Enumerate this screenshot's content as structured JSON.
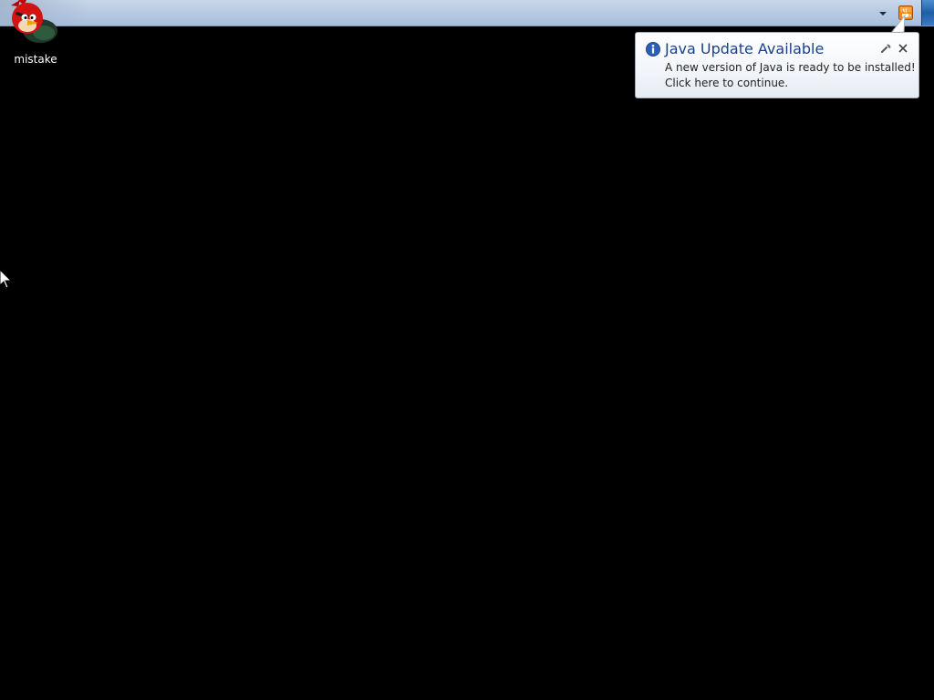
{
  "desktop": {
    "background_color": "#000000",
    "icons": [
      {
        "label": "mistake",
        "icon": "angry-bird-icon"
      }
    ]
  },
  "taskbar": {
    "tray": {
      "overflow_icon": "chevron-down-icon",
      "java_icon": "java-update-icon",
      "show_desktop": "show-desktop-button"
    }
  },
  "notification": {
    "icon": "info-icon",
    "title": "Java Update Available",
    "message_line1": "A new version of Java is ready to be installed!",
    "message_line2": "Click here to continue.",
    "title_color": "#1a3f8e",
    "options_icon": "wrench-icon",
    "close_icon": "close-icon"
  },
  "cursor": {
    "icon": "arrow-cursor-icon"
  }
}
